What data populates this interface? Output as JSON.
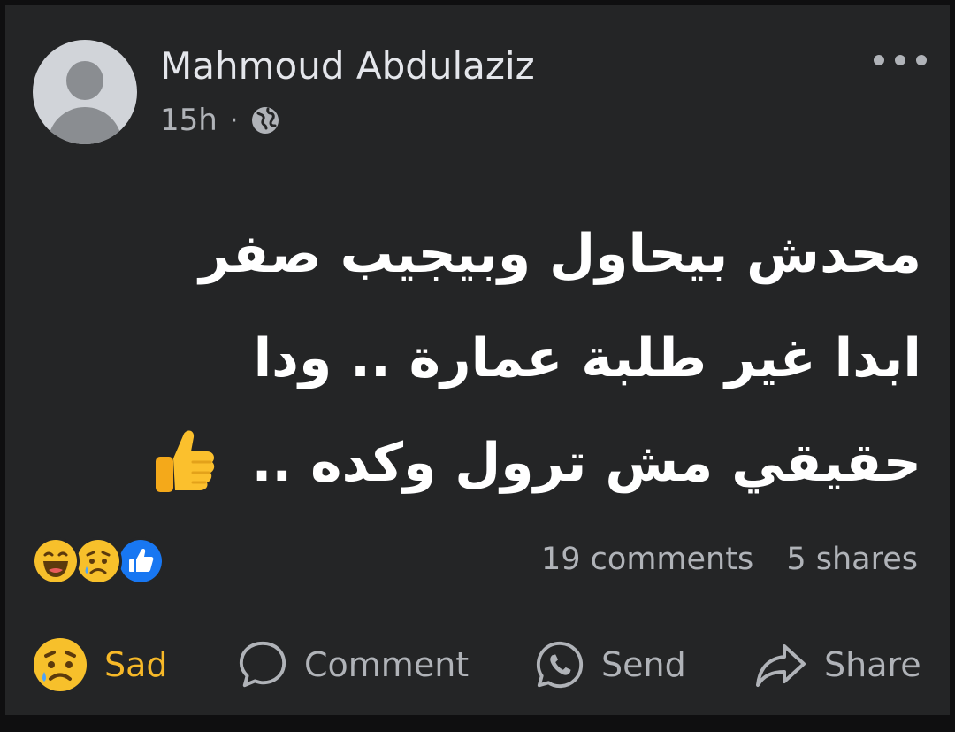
{
  "post": {
    "author": "Mahmoud Abdulaziz",
    "time": "15h",
    "separator": "·",
    "privacy_icon": "globe-icon",
    "more_icon": "more-options-icon",
    "text_lines": [
      "محدش بيحاول وبيجيب صفر",
      "ابدا غير طلبة عمارة .. ودا",
      "حقيقي مش ترول وكده .."
    ],
    "trailing_emoji": "thumbs-up-emoji"
  },
  "reactions": {
    "icons": [
      "haha-reaction-icon",
      "sad-reaction-icon",
      "like-reaction-icon"
    ],
    "comments": "19 comments",
    "shares": "5 shares"
  },
  "actions": {
    "sad": "Sad",
    "comment": "Comment",
    "send": "Send",
    "share": "Share"
  },
  "colors": {
    "card_background": "#242526",
    "primary_text": "#e4e6eb",
    "secondary_text": "#b0b3b8",
    "sad_accent": "#f7b928",
    "like_blue": "#1877f2"
  }
}
